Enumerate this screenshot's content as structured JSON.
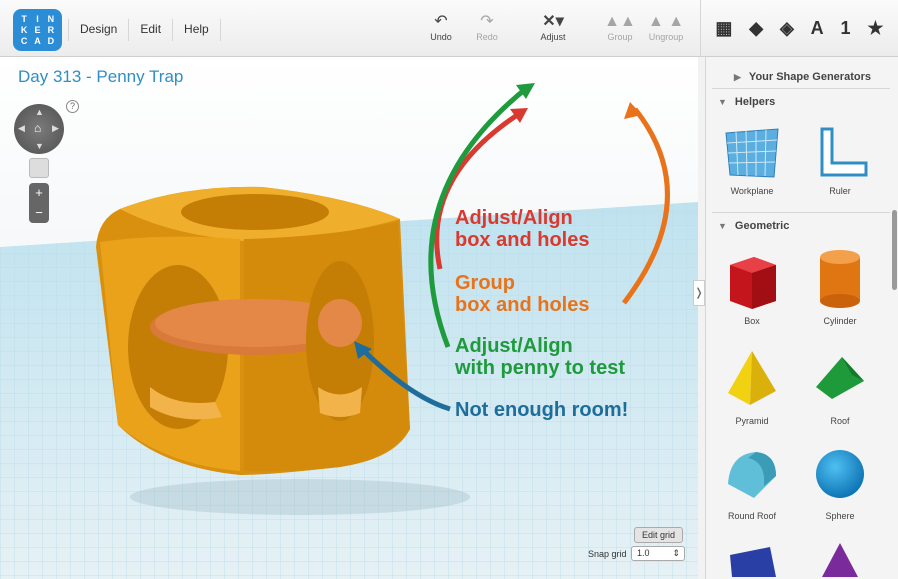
{
  "logo": {
    "letters": [
      "T",
      "I",
      "N",
      "K",
      "E",
      "R",
      "C",
      "A",
      "D"
    ]
  },
  "menu": {
    "design": "Design",
    "edit": "Edit",
    "help": "Help"
  },
  "toolbar": {
    "undo": "Undo",
    "redo": "Redo",
    "adjust": "Adjust",
    "group": "Group",
    "ungroup": "Ungroup"
  },
  "view_icons": {
    "letter": "A",
    "number": "1"
  },
  "workspace": {
    "title": "Day 313 - Penny Trap",
    "help": "?",
    "edit_grid": "Edit grid",
    "snap_grid_label": "Snap grid",
    "snap_grid_value": "1.0"
  },
  "annotations": {
    "adjust_align_1": "Adjust/Align",
    "adjust_align_2": "box and holes",
    "group_1": "Group",
    "group_2": "box and holes",
    "test_1": "Adjust/Align",
    "test_2": "with penny to test",
    "room": "Not enough room!"
  },
  "colors": {
    "red": "#d93a30",
    "orange": "#e8731a",
    "green": "#1f9a3c",
    "blue": "#1e6d9a",
    "box": "#e9a21a",
    "penny": "#d9793a",
    "accent": "#2f8fc4"
  },
  "sidebar": {
    "generators": "Your Shape Generators",
    "helpers": "Helpers",
    "geometric": "Geometric",
    "helper_items": [
      "Workplane",
      "Ruler"
    ],
    "shapes": [
      "Box",
      "Cylinder",
      "Pyramid",
      "Roof",
      "Round Roof",
      "Sphere"
    ]
  }
}
